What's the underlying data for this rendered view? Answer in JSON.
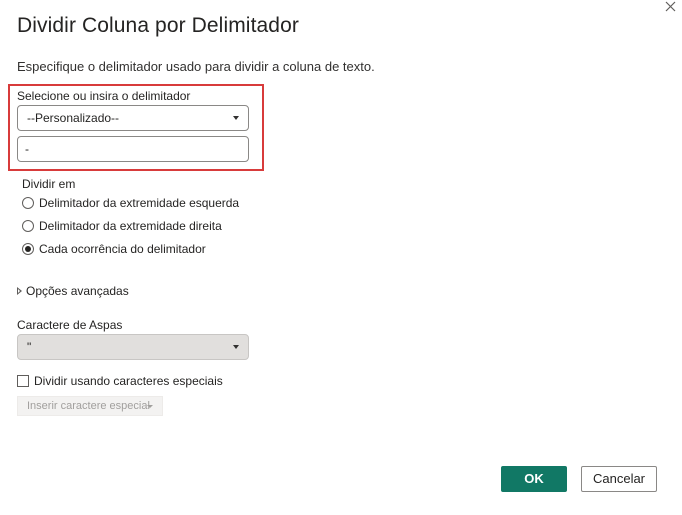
{
  "dialog": {
    "title": "Dividir Coluna por Delimitador",
    "description": "Especifique o delimitador usado para dividir a coluna de texto."
  },
  "delimiter": {
    "label": "Selecione ou insira o delimitador",
    "selected": "--Personalizado--",
    "custom_value": "-"
  },
  "split_at": {
    "label": "Dividir em",
    "options": [
      {
        "label": "Delimitador da extremidade esquerda",
        "checked": false
      },
      {
        "label": "Delimitador da extremidade direita",
        "checked": false
      },
      {
        "label": "Cada ocorrência do delimitador",
        "checked": true
      }
    ]
  },
  "advanced": {
    "label": "Opções avançadas"
  },
  "quote": {
    "label": "Caractere de Aspas",
    "selected": "\""
  },
  "special": {
    "checkbox_label": "Dividir usando caracteres especiais",
    "checked": false,
    "insert_label": "Inserir caractere especial"
  },
  "footer": {
    "ok_label": "OK",
    "cancel_label": "Cancelar"
  },
  "icons": {
    "close": "close-icon",
    "chevron": "chevron-down-icon",
    "expand": "chevron-right-icon"
  },
  "colors": {
    "primary": "#117865",
    "highlight": "#d83b3b"
  }
}
